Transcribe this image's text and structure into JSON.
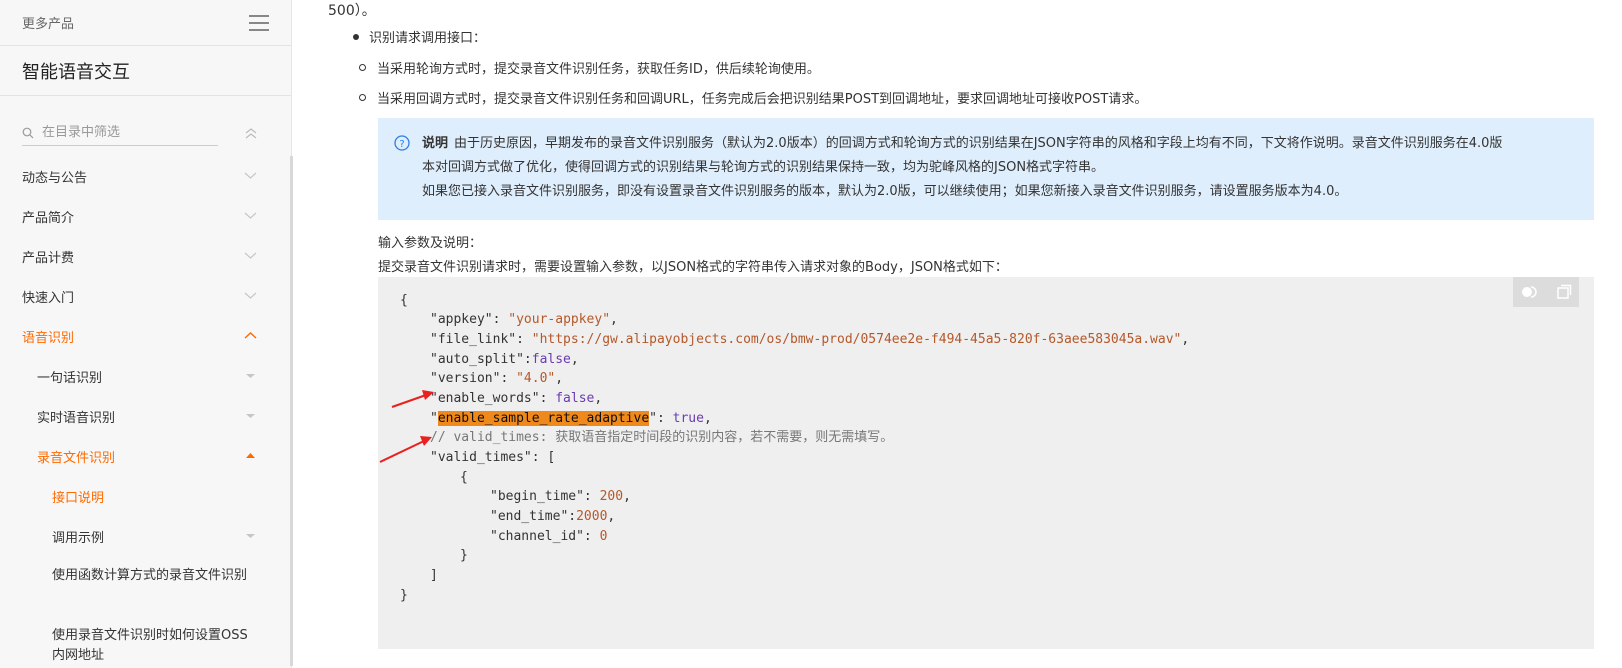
{
  "sidebar": {
    "more_products": "更多产品",
    "title": "智能语音交互",
    "search_placeholder": "在目录中筛选",
    "items": [
      {
        "label": "动态与公告"
      },
      {
        "label": "产品简介"
      },
      {
        "label": "产品计费"
      },
      {
        "label": "快速入门"
      },
      {
        "label": "语音识别"
      },
      {
        "label": "一句话识别"
      },
      {
        "label": "实时语音识别"
      },
      {
        "label": "录音文件识别"
      },
      {
        "label": "接口说明"
      },
      {
        "label": "调用示例"
      },
      {
        "label": "使用函数计算方式的录音文件识别"
      },
      {
        "label": "使用录音文件识别时如何设置OSS内网地址"
      }
    ]
  },
  "main": {
    "topline": "500）。",
    "bullet": "识别请求调用接口：",
    "sub1": "当采用轮询方式时，提交录音文件识别任务，获取任务ID，供后续轮询使用。",
    "sub2": "当采用回调方式时，提交录音文件识别任务和回调URL，任务完成后会把识别结果POST到回调地址，要求回调地址可接收POST请求。",
    "note": {
      "title": "说明",
      "line1": "由于历史原因，早期发布的录音文件识别服务（默认为2.0版本）的回调方式和轮询方式的识别结果在JSON字符串的风格和字段上均有不同，下文将作说明。录音文件识别服务在4.0版",
      "line2": "本对回调方式做了优化，使得回调方式的识别结果与轮询方式的识别结果保持一致，均为驼峰风格的JSON格式字符串。",
      "line3": "如果您已接入录音文件识别服务，即没有设置录音文件识别服务的版本，默认为2.0版，可以继续使用；如果您新接入录音文件识别服务，请设置服务版本为4.0。"
    },
    "label1": "输入参数及说明：",
    "label2": "提交录音文件识别请求时，需要设置输入参数，以JSON格式的字符串传入请求对象的Body，JSON格式如下：",
    "code": {
      "l1": "{",
      "l2_key": "\"appkey\"",
      "l2_val": "\"your-appkey\"",
      "l3_key": "\"file_link\"",
      "l3_val": "\"https://gw.alipayobjects.com/os/bmw-prod/0574ee2e-f494-45a5-820f-63aee583045a.wav\"",
      "l4_key": "\"auto_split\"",
      "l4_val": "false",
      "l5_key": "\"version\"",
      "l5_val": "\"4.0\"",
      "l6_key": "\"enable_words\"",
      "l6_val": "false",
      "l7_key": "enable_sample_rate_adaptive",
      "l7_val": "true",
      "l8": "// valid_times: 获取语音指定时间段的识别内容，若不需要，则无需填写。",
      "l9_key": "\"valid_times\"",
      "l10": "{",
      "l11_key": "\"begin_time\"",
      "l11_val": "200",
      "l12_key": "\"end_time\"",
      "l12_val": "2000",
      "l13_key": "\"channel_id\"",
      "l13_val": "0",
      "l14": "}",
      "l15": "]",
      "l16": "}"
    }
  },
  "colors": {
    "accent": "#ff6a00",
    "note_bg": "#dfeefc",
    "highlight": "#f0891b",
    "arrow": "#e8201e"
  }
}
